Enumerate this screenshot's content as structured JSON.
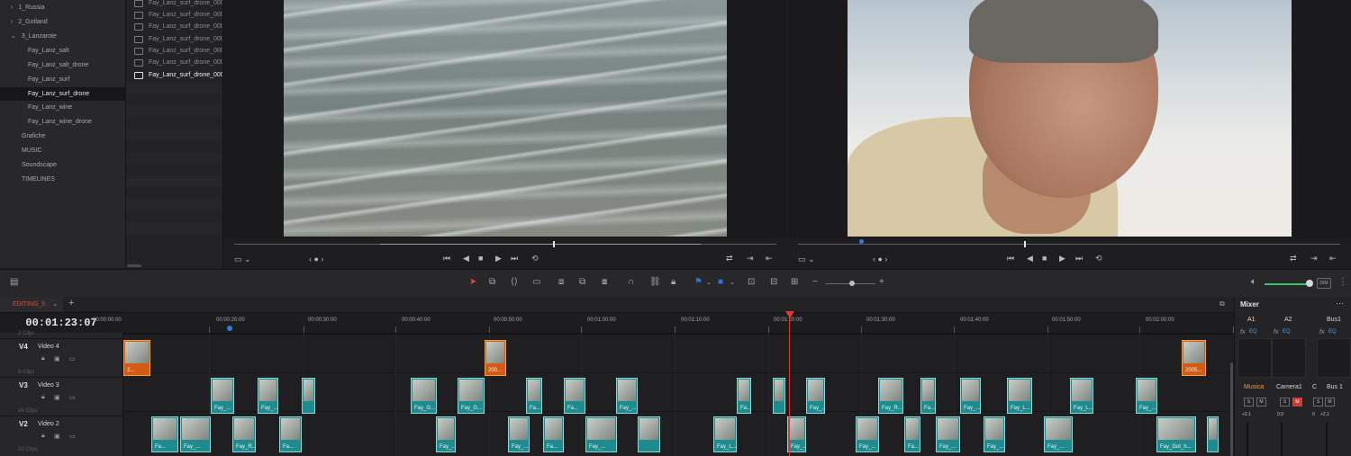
{
  "colors": {
    "accent_red": "#e0392f",
    "clip_teal": "#1e8c8e",
    "clip_orange": "#d35b12",
    "marker_blue": "#2f7be0",
    "volume_green": "#3dc46a"
  },
  "bins": [
    {
      "label": "1_Russia",
      "chevron": "›"
    },
    {
      "label": "2_Gotland",
      "chevron": "›"
    },
    {
      "label": "3_Lanzarote",
      "chevron": "⌄"
    },
    {
      "label": "Fay_Lanz_salt"
    },
    {
      "label": "Fay_Lanz_salt_drone"
    },
    {
      "label": "Fay_Lanz_surf"
    },
    {
      "label": "Fay_Lanz_surf_drone"
    },
    {
      "label": "Fay_Lanz_wine"
    },
    {
      "label": "Fay_Lanz_wine_drone"
    },
    {
      "label": "Grafiche"
    },
    {
      "label": "MUSIC"
    },
    {
      "label": "Soundscape"
    },
    {
      "label": "TIMELINES"
    }
  ],
  "clip_list": [
    "Fay_Lanz_surf_drone_000",
    "Fay_Lanz_surf_drone_000",
    "Fay_Lanz_surf_drone_000",
    "Fay_Lanz_surf_drone_000",
    "Fay_Lanz_surf_drone_000",
    "Fay_Lanz_surf_drone_000",
    "Fay_Lanz_surf_drone_000"
  ],
  "timeline": {
    "tab_name": "EDITING_5",
    "tab_chevron": "⌄",
    "add_label": "+",
    "timecode": "00:01:23:07",
    "ruler": [
      "00:00:00:00",
      "00:00:20:00",
      "00:00:30:00",
      "00:00:40:00",
      "00:00:50:00",
      "00:01:00:00",
      "00:01:10:00",
      "00:01:20:00",
      "00:01:30:00",
      "00:01:40:00",
      "00:01:50:00",
      "00:02:00:00"
    ],
    "tracks": [
      {
        "id": "V4",
        "name": "Video 4",
        "clips_above": "2 Clips"
      },
      {
        "id": "V3",
        "name": "Video 3",
        "clips_above": "6 Clips"
      },
      {
        "id": "V2",
        "name": "Video 2",
        "clips_above": "24 Clips"
      }
    ],
    "last_clips_count": "23 Clips",
    "v4_clips": [
      "2...",
      "200...",
      "2005..."
    ],
    "v3_clips": [
      "Fay_...",
      "Fay_...",
      "",
      "Fay_G...",
      "Fay_G...",
      "Fa...",
      "Fa...",
      "Fay_...",
      "Fa...",
      "",
      "Fay_...",
      "Fay_R...",
      "Fa...",
      "Fay_...",
      "Fay_L...",
      "Fay_L...",
      "Fay_..."
    ],
    "v2_clips": [
      "Fa...",
      "Fay_...",
      "Fay_R...",
      "Fa...",
      "Fay_...",
      "Fay_...",
      "Fa...",
      "Fay_...",
      "",
      "Fay_L...",
      "Fay_...",
      "Fay_...",
      "Fa...",
      "Fay_...",
      "Fay_...",
      "Fay_...",
      "Fay_Got_h...",
      ""
    ]
  },
  "mixer": {
    "title": "Mixer",
    "menu": "···",
    "channels": [
      "A1",
      "A2",
      "Bus1"
    ],
    "strips": [
      "Musica",
      "Camera1",
      "C",
      "Bus 1"
    ],
    "fx": "fx",
    "eq": "EQ",
    "solo": "S",
    "mute": "M",
    "levels": [
      "+2.1",
      "0.0",
      "0",
      "+2.1"
    ]
  },
  "toolbar": {
    "dim": "DIM",
    "src_view_icon": "▭ ⌄",
    "src_jog": "‹ ● ›",
    "tl_view_icon": "▭ ⌄",
    "tl_jog": "‹ ● ›"
  }
}
